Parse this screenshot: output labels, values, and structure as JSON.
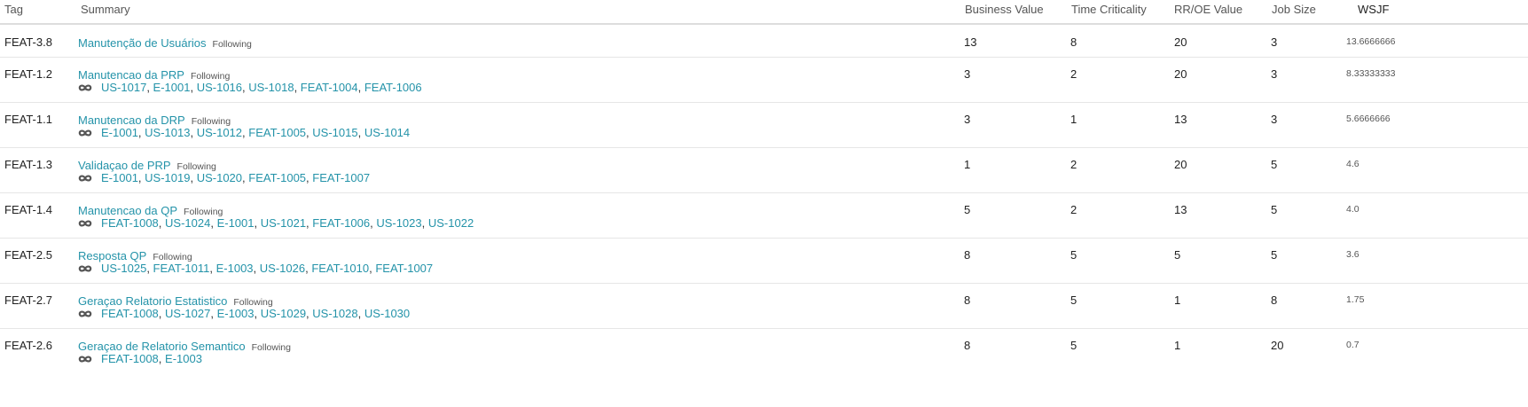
{
  "columns": {
    "tag": "Tag",
    "summary": "Summary",
    "business_value": "Business Value",
    "time_criticality": "Time Criticality",
    "rr_oe_value": "RR/OE Value",
    "job_size": "Job Size",
    "wsjf": "WSJF"
  },
  "following_label": "Following",
  "rows": [
    {
      "tag": "FEAT-3.8",
      "title": "Manutenção de Usuários",
      "links": [],
      "business_value": "13",
      "time_criticality": "8",
      "rr_oe_value": "20",
      "job_size": "3",
      "wsjf": "13.6666666"
    },
    {
      "tag": "FEAT-1.2",
      "title": "Manutencao da PRP",
      "links": [
        "US-1017",
        "E-1001",
        "US-1016",
        "US-1018",
        "FEAT-1004",
        "FEAT-1006"
      ],
      "business_value": "3",
      "time_criticality": "2",
      "rr_oe_value": "20",
      "job_size": "3",
      "wsjf": "8.33333333"
    },
    {
      "tag": "FEAT-1.1",
      "title": "Manutencao da DRP",
      "links": [
        "E-1001",
        "US-1013",
        "US-1012",
        "FEAT-1005",
        "US-1015",
        "US-1014"
      ],
      "business_value": "3",
      "time_criticality": "1",
      "rr_oe_value": "13",
      "job_size": "3",
      "wsjf": "5.6666666"
    },
    {
      "tag": "FEAT-1.3",
      "title": "Validaçao de PRP",
      "links": [
        "E-1001",
        "US-1019",
        "US-1020",
        "FEAT-1005",
        "FEAT-1007"
      ],
      "business_value": "1",
      "time_criticality": "2",
      "rr_oe_value": "20",
      "job_size": "5",
      "wsjf": "4.6"
    },
    {
      "tag": "FEAT-1.4",
      "title": "Manutencao da QP",
      "links": [
        "FEAT-1008",
        "US-1024",
        "E-1001",
        "US-1021",
        "FEAT-1006",
        "US-1023",
        "US-1022"
      ],
      "business_value": "5",
      "time_criticality": "2",
      "rr_oe_value": "13",
      "job_size": "5",
      "wsjf": "4.0"
    },
    {
      "tag": "FEAT-2.5",
      "title": "Resposta QP",
      "links": [
        "US-1025",
        "FEAT-1011",
        "E-1003",
        "US-1026",
        "FEAT-1010",
        "FEAT-1007"
      ],
      "business_value": "8",
      "time_criticality": "5",
      "rr_oe_value": "5",
      "job_size": "5",
      "wsjf": "3.6"
    },
    {
      "tag": "FEAT-2.7",
      "title": "Geraçao Relatorio Estatistico",
      "links": [
        "FEAT-1008",
        "US-1027",
        "E-1003",
        "US-1029",
        "US-1028",
        "US-1030"
      ],
      "business_value": "8",
      "time_criticality": "5",
      "rr_oe_value": "1",
      "job_size": "8",
      "wsjf": "1.75"
    },
    {
      "tag": "FEAT-2.6",
      "title": "Geraçao de Relatorio Semantico",
      "links": [
        "FEAT-1008",
        "E-1003"
      ],
      "business_value": "8",
      "time_criticality": "5",
      "rr_oe_value": "1",
      "job_size": "20",
      "wsjf": "0.7"
    }
  ],
  "icons": {
    "link": "link-icon"
  },
  "colors": {
    "link": "#2493a9",
    "header_border": "#dddddd",
    "row_border": "#e6e6e6"
  }
}
